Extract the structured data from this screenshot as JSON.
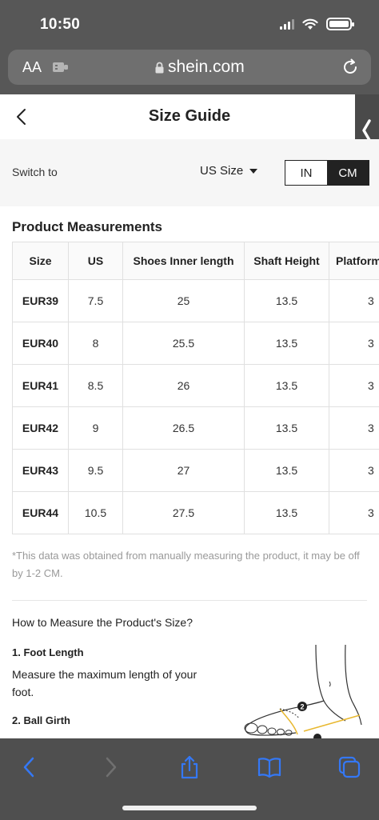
{
  "status_bar": {
    "time": "10:50"
  },
  "browser": {
    "aa_label": "AA",
    "url": "shein.com"
  },
  "page": {
    "title": "Size Guide",
    "switch_to_label": "Switch to",
    "size_system": "US Size",
    "units": {
      "in": "IN",
      "cm": "CM",
      "selected": "CM"
    },
    "section_title": "Product Measurements",
    "table": {
      "headers": [
        "Size",
        "US",
        "Shoes Inner length",
        "Shaft Height",
        "Platform"
      ],
      "rows": [
        [
          "EUR39",
          "7.5",
          "25",
          "13.5",
          "3"
        ],
        [
          "EUR40",
          "8",
          "25.5",
          "13.5",
          "3"
        ],
        [
          "EUR41",
          "8.5",
          "26",
          "13.5",
          "3"
        ],
        [
          "EUR42",
          "9",
          "26.5",
          "13.5",
          "3"
        ],
        [
          "EUR43",
          "9.5",
          "27",
          "13.5",
          "3"
        ],
        [
          "EUR44",
          "10.5",
          "27.5",
          "13.5",
          "3"
        ]
      ]
    },
    "note": "*This data was obtained from manually measuring the product, it may be off by 1-2 CM.",
    "how_to_title": "How to Measure the Product's Size?",
    "steps": [
      {
        "title": "1. Foot Length",
        "text": "Measure the maximum length of your foot."
      },
      {
        "title": "2. Ball Girth"
      }
    ],
    "illustration_badge": "2"
  },
  "colors": {
    "chrome": "#575757",
    "url_bar": "#6f6f6f",
    "toolbar": "#4f4f4f",
    "toolbar_icon": "#3478f6",
    "selected_unit": "#222222"
  }
}
